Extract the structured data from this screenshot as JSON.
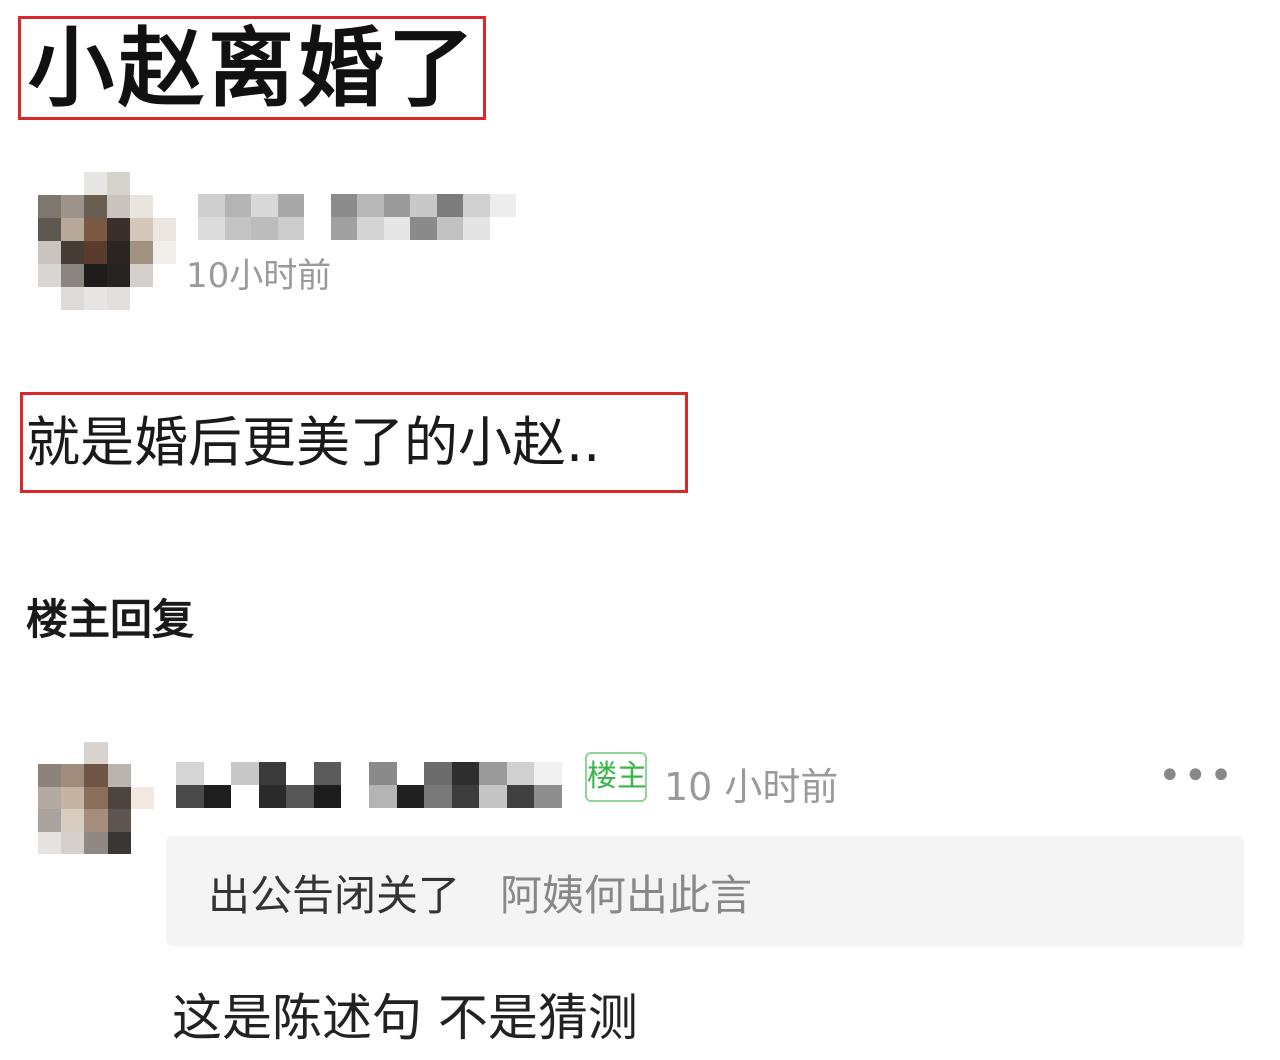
{
  "post": {
    "title": "小赵离婚了",
    "author": {
      "time": "10小时前"
    },
    "body": "就是婚后更美了的小赵.."
  },
  "replies_section": {
    "heading": "楼主回复",
    "reply": {
      "op_badge": "楼主",
      "time": "10 小时前",
      "more_icon": "more-horizontal-icon",
      "more_label": "•••",
      "quoted": {
        "author": "出公告闭关了",
        "text": "阿姨何出此言"
      },
      "text": "这是陈述句 不是猜测"
    }
  },
  "colors": {
    "highlight_border": "#d8282c",
    "op_badge": "#3ab54a",
    "muted_text": "#9a9a9a",
    "quote_background": "#f4f4f4"
  }
}
